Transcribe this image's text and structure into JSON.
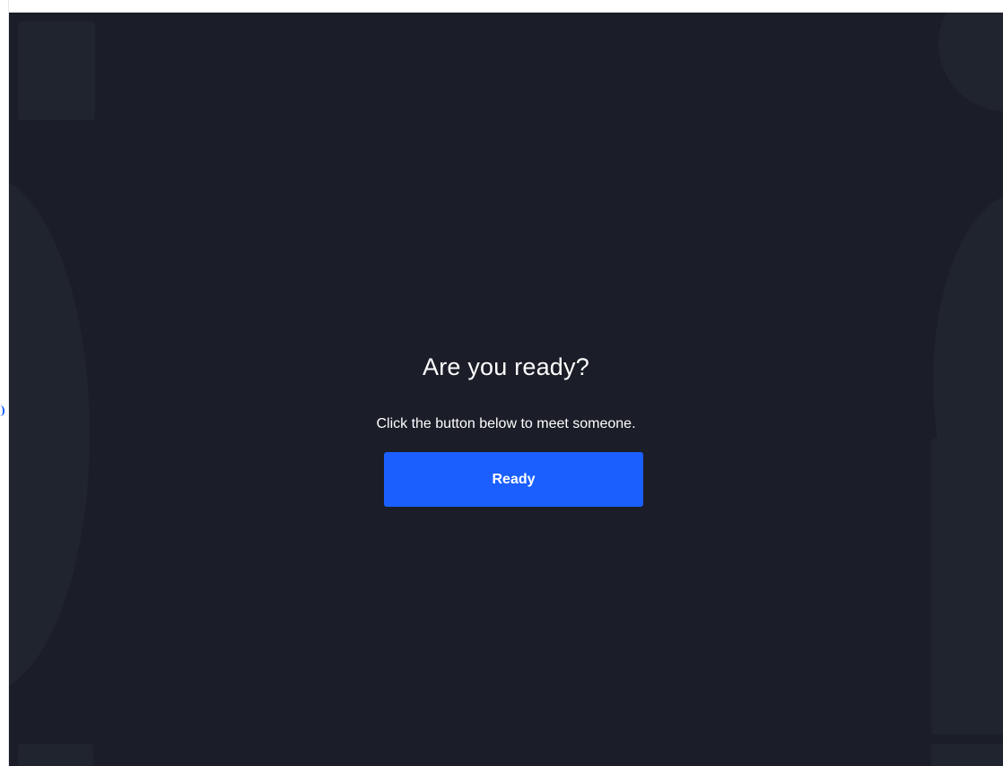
{
  "screen": {
    "title": "Are you ready?",
    "subtitle": "Click the button below to meet someone.",
    "ready_button_label": "Ready"
  },
  "colors": {
    "background": "#1b1e28",
    "accent": "#1b5fff",
    "text": "#ffffff"
  }
}
